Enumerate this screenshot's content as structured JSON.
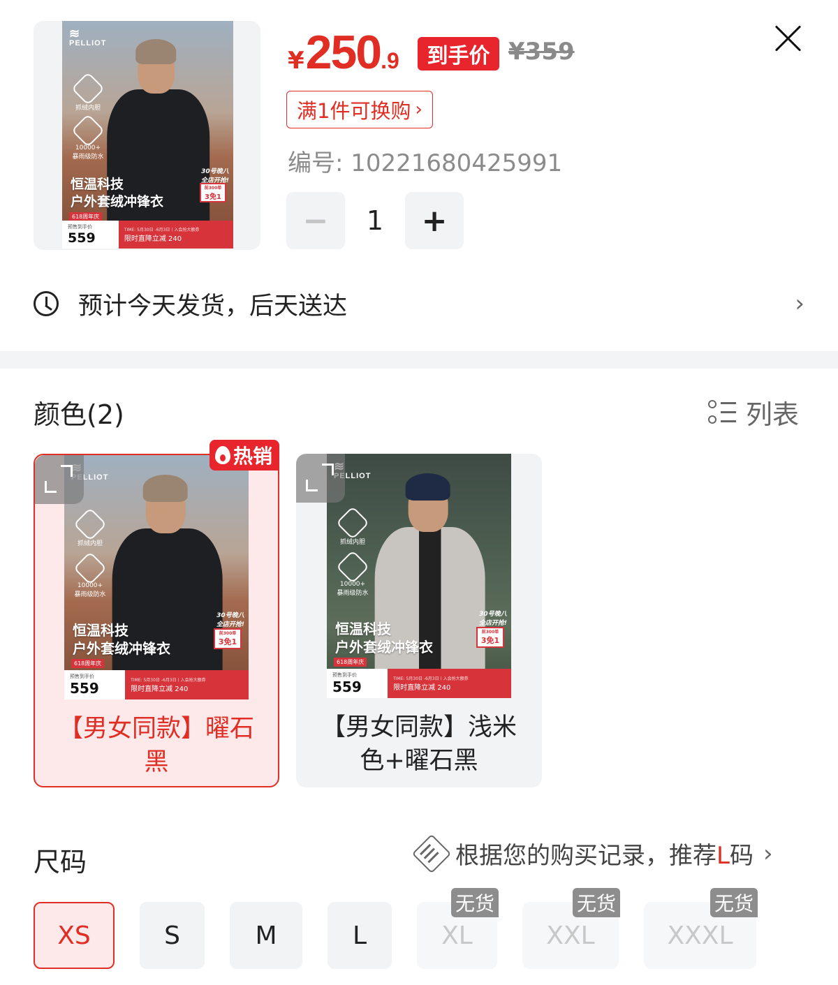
{
  "product": {
    "brand_logo": "PELLIOT",
    "thumbnail": {
      "headline_line1": "恒温科技",
      "headline_line2": "户外套绒冲锋衣",
      "feature1": "抓绒内胆",
      "feature2_a": "10000+",
      "feature2_b": "暴雨级防水",
      "anniversary": "618周年庆",
      "promo_price_caption": "预售到手价",
      "promo_price": "559",
      "promo_time": "TIME: 5月30日 -6月3日丨入会抢大额券",
      "promo_text": "限时直降立减 240",
      "event_line1": "30号晚八",
      "event_line2": "全店开抢!",
      "event_badge_top": "前300单",
      "event_badge_main": "3免1"
    }
  },
  "price": {
    "currency": "¥",
    "integer": "250",
    "decimal": ".9",
    "final_label": "到手价",
    "original": "¥359"
  },
  "swap_offer": {
    "label": "满1件可换购",
    "chevron": "›"
  },
  "sku": {
    "label": "编号: 10221680425991"
  },
  "quantity": {
    "minus": "−",
    "value": "1",
    "plus": "+"
  },
  "shipping": {
    "text": "预计今天发货，后天送达",
    "chevron": "›",
    "icon": "clock-icon"
  },
  "color_section": {
    "title": "颜色(2)",
    "view_toggle": "列表",
    "hot_label": "热销",
    "options": [
      {
        "label": "【男女同款】曜石黑",
        "selected": true
      },
      {
        "label": "【男女同款】浅米色+曜石黑",
        "selected": false
      }
    ]
  },
  "size_section": {
    "title": "尺码",
    "reco_prefix": "根据您的购买记录，推荐",
    "reco_size": "L",
    "reco_suffix": "码",
    "reco_chevron": "›",
    "soldout_label": "无货",
    "sizes": [
      {
        "label": "XS",
        "state": "selected"
      },
      {
        "label": "S",
        "state": "available"
      },
      {
        "label": "M",
        "state": "available"
      },
      {
        "label": "L",
        "state": "available"
      },
      {
        "label": "XL",
        "state": "soldout"
      },
      {
        "label": "XXL",
        "state": "soldout"
      },
      {
        "label": "XXXL",
        "state": "soldout"
      }
    ]
  },
  "colors": {
    "accent": "#e02e24",
    "tag_red": "#e8242d",
    "muted_bg": "#f2f3f5",
    "soldout_gray": "#8d8d8d"
  }
}
